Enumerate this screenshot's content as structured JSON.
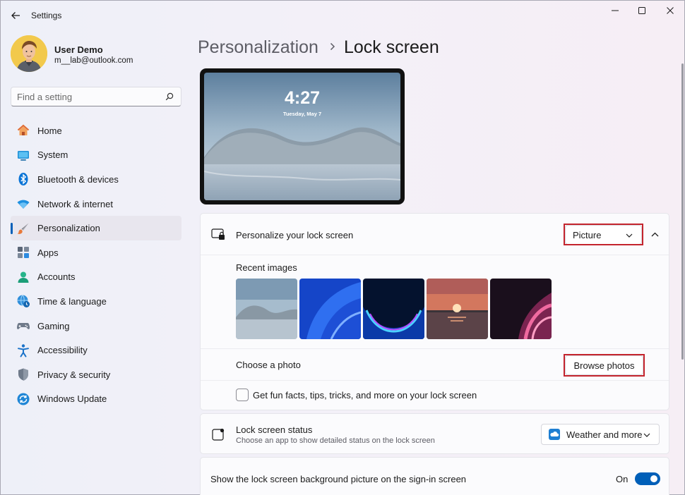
{
  "window": {
    "title": "Settings"
  },
  "profile": {
    "name": "User Demo",
    "email": "m__lab@outlook.com"
  },
  "search": {
    "placeholder": "Find a setting"
  },
  "nav": [
    {
      "label": "Home",
      "icon": "home-icon",
      "active": false
    },
    {
      "label": "System",
      "icon": "system-icon",
      "active": false
    },
    {
      "label": "Bluetooth & devices",
      "icon": "bluetooth-icon",
      "active": false
    },
    {
      "label": "Network & internet",
      "icon": "wifi-icon",
      "active": false
    },
    {
      "label": "Personalization",
      "icon": "brush-icon",
      "active": true
    },
    {
      "label": "Apps",
      "icon": "apps-icon",
      "active": false
    },
    {
      "label": "Accounts",
      "icon": "accounts-icon",
      "active": false
    },
    {
      "label": "Time & language",
      "icon": "globe-clock-icon",
      "active": false
    },
    {
      "label": "Gaming",
      "icon": "gamepad-icon",
      "active": false
    },
    {
      "label": "Accessibility",
      "icon": "accessibility-icon",
      "active": false
    },
    {
      "label": "Privacy & security",
      "icon": "shield-icon",
      "active": false
    },
    {
      "label": "Windows Update",
      "icon": "update-icon",
      "active": false
    }
  ],
  "breadcrumb": {
    "parent": "Personalization",
    "current": "Lock screen"
  },
  "preview": {
    "time": "4:27",
    "date": "Tuesday, May 7"
  },
  "personalize": {
    "label": "Personalize your lock screen",
    "selected": "Picture",
    "recent_label": "Recent images",
    "recent_images": [
      "wallpaper-landscape-hills",
      "wallpaper-blue-bloom",
      "wallpaper-glow-curve",
      "wallpaper-sunset-lake",
      "wallpaper-pink-ribbons"
    ],
    "choose_label": "Choose a photo",
    "browse_label": "Browse photos",
    "facts_label": "Get fun facts, tips, tricks, and more on your lock screen",
    "facts_checked": false
  },
  "status": {
    "label": "Lock screen status",
    "description": "Choose an app to show detailed status on the lock screen",
    "selected": "Weather and more"
  },
  "signin": {
    "label": "Show the lock screen background picture on the sign-in screen",
    "state": "On",
    "enabled": true
  },
  "colors": {
    "accent": "#005fb8",
    "highlight": "#c4242d"
  }
}
